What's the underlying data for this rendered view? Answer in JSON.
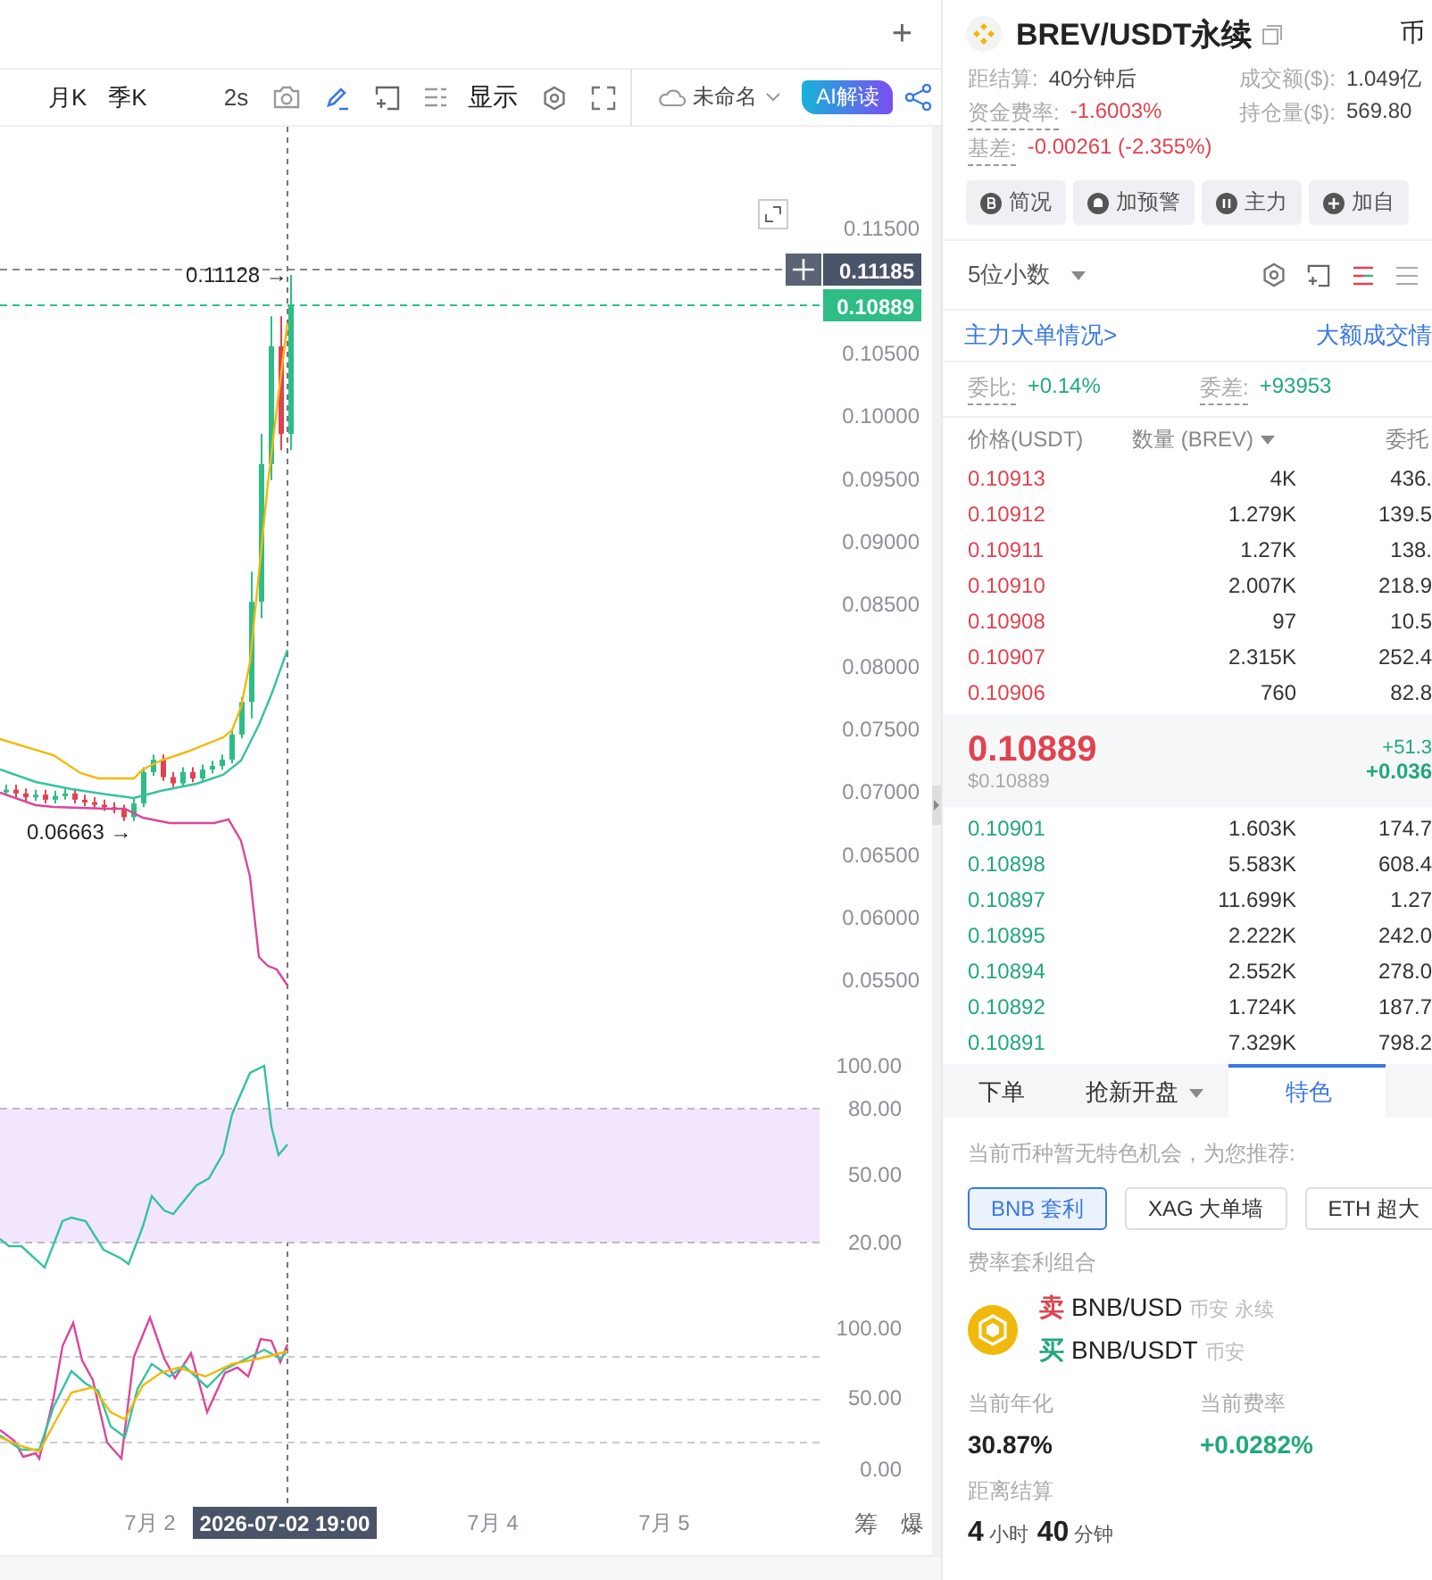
{
  "top_bar": {
    "add_tab": "+"
  },
  "toolbar": {
    "periods": [
      {
        "label": "月K"
      },
      {
        "label": "季K"
      }
    ],
    "refresh": "2s",
    "display": "显示",
    "layout_name": "未命名",
    "ai_button": "AI解读"
  },
  "chart": {
    "price_axis": [
      "0.11500",
      "0.10500",
      "0.10000",
      "0.09500",
      "0.09000",
      "0.08500",
      "0.08000",
      "0.07500",
      "0.07000",
      "0.06500",
      "0.06000",
      "0.05500"
    ],
    "high_label": "0.11128 →",
    "low_label": "0.06663 →",
    "crosshair_price": "0.11185",
    "last_price": "0.10889",
    "rsi_axis": [
      "100.00",
      "80.00",
      "50.00",
      "20.00"
    ],
    "kdj_axis": [
      "100.00",
      "50.00",
      "0.00"
    ],
    "x_labels": [
      "7月 2",
      "7月 4",
      "7月 5"
    ],
    "crosshair_time": "2026-07-02 19:00",
    "side_tabs": [
      "筹",
      "爆"
    ]
  },
  "market": {
    "header": {
      "symbol": "BREV/USDT永续",
      "exchange": "币"
    },
    "stats": [
      {
        "label": "距结算:",
        "value": "40分钟后",
        "color": "#444444",
        "dotted": false
      },
      {
        "label": "成交额($):",
        "value": "1.049亿",
        "color": "#444444",
        "dotted": false
      },
      {
        "label": "资金费率:",
        "value": "-1.6003%",
        "color": "#e0434f",
        "dotted": true
      },
      {
        "label": "持仓量($):",
        "value": "569.80",
        "color": "#444444",
        "dotted": false
      },
      {
        "label": "基差:",
        "value": "-0.00261 (-2.355%)",
        "color": "#e0434f",
        "dotted": true
      }
    ],
    "actions": [
      {
        "kind": "brief",
        "label": "简况"
      },
      {
        "kind": "alert",
        "label": "加预警"
      },
      {
        "kind": "whale",
        "label": "主力"
      },
      {
        "kind": "add",
        "label": "加自"
      }
    ],
    "precision": "5位小数",
    "links": [
      "主力大单情况>",
      "大额成交情"
    ],
    "ratio": [
      {
        "label": "委比:",
        "value": "+0.14%"
      },
      {
        "label": "委差:",
        "value": "+93953"
      }
    ],
    "book_columns": [
      "价格(USDT)",
      "数量 (BREV)",
      "委托"
    ],
    "asks": [
      {
        "price": "0.10913",
        "qty": "4K",
        "amount": "436."
      },
      {
        "price": "0.10912",
        "qty": "1.279K",
        "amount": "139.5"
      },
      {
        "price": "0.10911",
        "qty": "1.27K",
        "amount": "138."
      },
      {
        "price": "0.10910",
        "qty": "2.007K",
        "amount": "218.9"
      },
      {
        "price": "0.10908",
        "qty": "97",
        "amount": "10.5"
      },
      {
        "price": "0.10907",
        "qty": "2.315K",
        "amount": "252.4"
      },
      {
        "price": "0.10906",
        "qty": "760",
        "amount": "82.8"
      }
    ],
    "last": {
      "price": "0.10889",
      "usd": "$0.10889",
      "change": "+51.3",
      "change_pct": "+0.036"
    },
    "bids": [
      {
        "price": "0.10901",
        "qty": "1.603K",
        "amount": "174.7"
      },
      {
        "price": "0.10898",
        "qty": "5.583K",
        "amount": "608.4"
      },
      {
        "price": "0.10897",
        "qty": "11.699K",
        "amount": "1.27"
      },
      {
        "price": "0.10895",
        "qty": "2.222K",
        "amount": "242.0"
      },
      {
        "price": "0.10894",
        "qty": "2.552K",
        "amount": "278.0"
      },
      {
        "price": "0.10892",
        "qty": "1.724K",
        "amount": "187.7"
      },
      {
        "price": "0.10891",
        "qty": "7.329K",
        "amount": "798.2"
      }
    ],
    "tabs": [
      {
        "label": "下单",
        "selected": false,
        "dropdown": false
      },
      {
        "label": "抢新开盘",
        "selected": false,
        "dropdown": true
      },
      {
        "label": "特色",
        "selected": true,
        "dropdown": false
      }
    ],
    "feature": {
      "notice": "当前币种暂无特色机会，为您推荐:",
      "chips": [
        {
          "label": "BNB 套利",
          "selected": true
        },
        {
          "label": "XAG 大单墙",
          "selected": false
        },
        {
          "label": "ETH 超大",
          "selected": false
        }
      ],
      "combo_title": "费率套利组合",
      "legs": [
        {
          "side": "卖",
          "kind": "sell",
          "pair": "BNB/USD",
          "venue": "币安 永续"
        },
        {
          "side": "买",
          "kind": "buy",
          "pair": "BNB/USDT",
          "venue": "币安"
        }
      ],
      "metrics": [
        {
          "label": "当前年化",
          "value": "30.87%",
          "color": "#222222"
        },
        {
          "label": "当前费率",
          "value": "+0.0282%",
          "color": "#22a879"
        }
      ],
      "countdown": {
        "label": "距离结算",
        "hours": "4",
        "hours_unit": "小时",
        "minutes": "40",
        "minutes_unit": "分钟"
      }
    }
  }
}
